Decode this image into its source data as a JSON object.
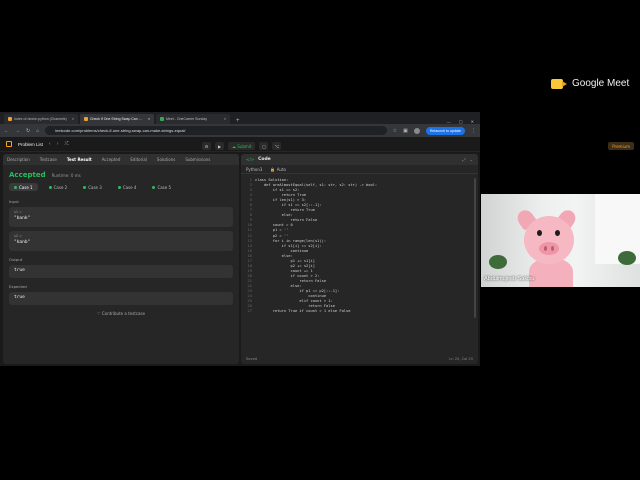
{
  "meet": {
    "brand": "Google Meet",
    "participant_name": "Abdulmujeeb Sakibu"
  },
  "browser": {
    "tabs": [
      {
        "label": "Index of /annie-python (Channels)",
        "active": false
      },
      {
        "label": "Check If One String Swap Can ...",
        "active": true
      },
      {
        "label": "Meet - OneCareer Sunday",
        "active": false
      }
    ],
    "url": "leetcode.com/problems/check-if-one-string-swap-can-make-strings-equal/",
    "relaunch": "Relaunch to update"
  },
  "leetcode": {
    "header": {
      "problem_list": "Problem List",
      "submit": "Submit",
      "premium": "Premium"
    },
    "left_tabs": [
      "Description",
      "Testcase",
      "Test Result",
      "Accepted",
      "Editorial",
      "Solutions",
      "Submissions"
    ],
    "active_left_tab": 2,
    "result": {
      "status": "Accepted",
      "runtime": "Runtime: 0 ms"
    },
    "cases": [
      "Case 1",
      "Case 2",
      "Case 3",
      "Case 4",
      "Case 5"
    ],
    "input_label": "Input",
    "inputs": [
      {
        "name": "s1 =",
        "value": "\"bank\""
      },
      {
        "name": "s2 =",
        "value": "\"kanb\""
      }
    ],
    "output_label": "Output",
    "output": "true",
    "expected_label": "Expected",
    "expected": "true",
    "contribute": "Contribute a testcase",
    "code_panel": {
      "title": "Code",
      "language": "Python3",
      "mode": "Auto",
      "footer_left": "Saved",
      "footer_right": "Ln 25, Col 25",
      "lines": [
        "class Solution:",
        "    def areAlmostEqual(self, s1: str, s2: str) -> bool:",
        "        if s1 == s2:",
        "            return True",
        "        if len(s1) > 3:",
        "            if s1 == s2[::-1]:",
        "                return True",
        "            else:",
        "                return False",
        "        count = 0",
        "        p1 = ''",
        "        p2 = ''",
        "        for i in range(len(s1)):",
        "            if s1[i] == s2[i]:",
        "                continue",
        "            else:",
        "                p1 += s1[i]",
        "                p2 += s2[i]",
        "                count += 1",
        "                if count > 2:",
        "                    return False",
        "                else:",
        "                    if p1 == p2[::-1]:",
        "                        continue",
        "                    elif count > 1:",
        "                        return False",
        "        return True if count > 1 else False"
      ]
    }
  }
}
